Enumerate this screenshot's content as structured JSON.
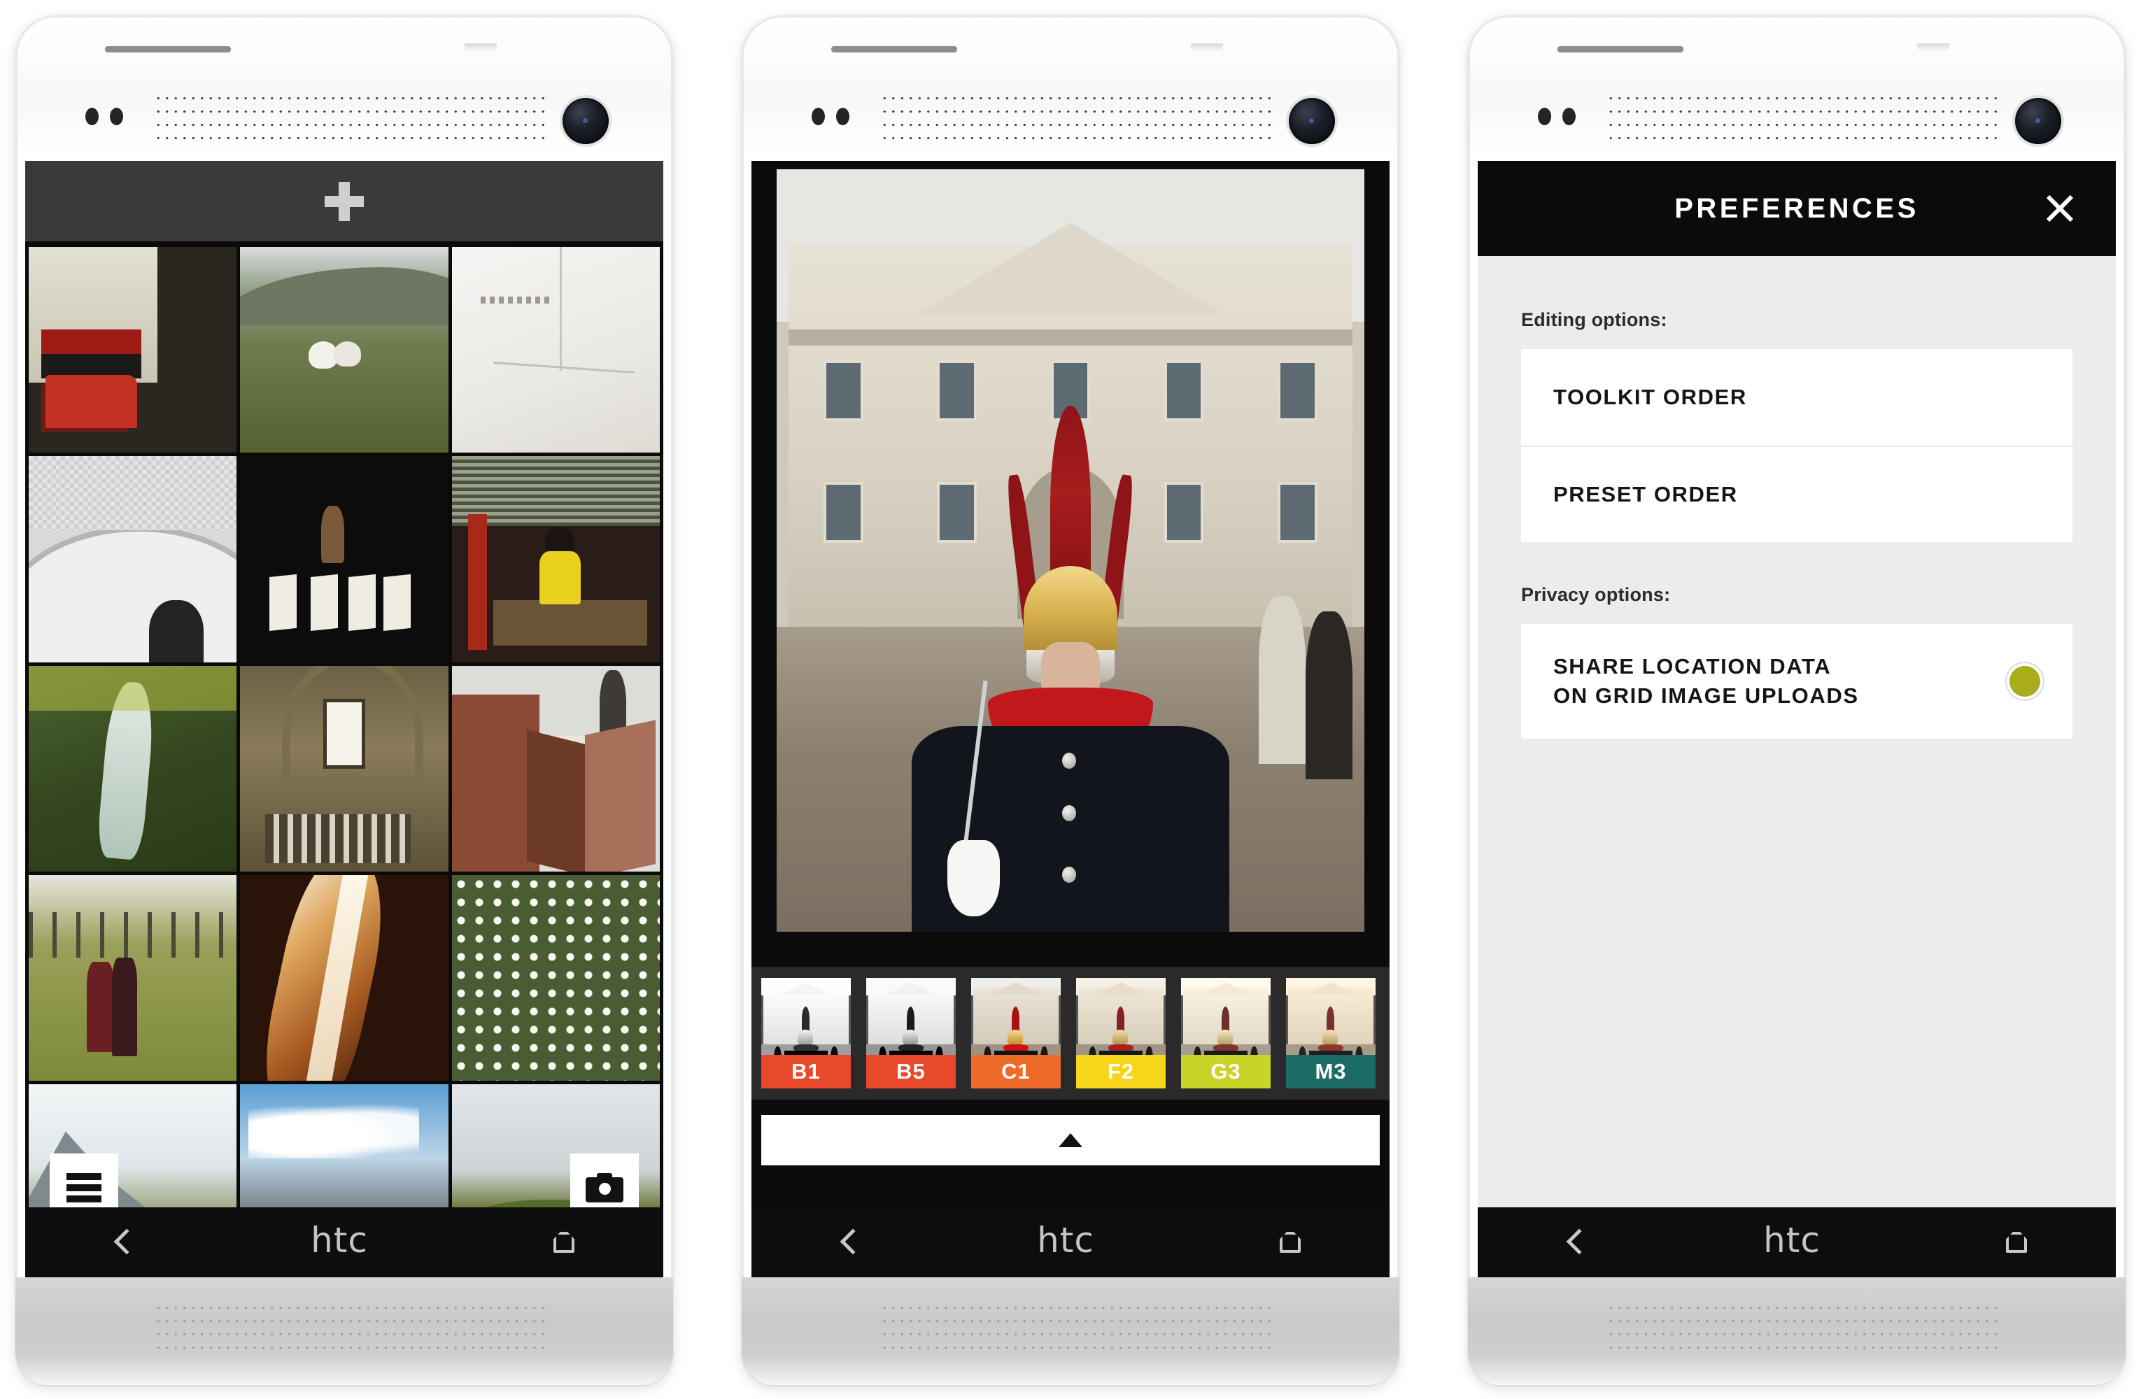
{
  "device": {
    "brand_logo": "htc",
    "nav_back_icon": "chevron-left-icon",
    "nav_home_icon": "home-icon"
  },
  "screens": [
    {
      "id": "grid",
      "name": "Grid / Library",
      "topbar": {
        "add_icon": "plus-icon",
        "add_label": "+"
      },
      "overlay_buttons": [
        {
          "name": "menu-button",
          "icon": "hamburger-icon"
        },
        {
          "name": "camera-button",
          "icon": "camera-icon"
        }
      ],
      "thumbnails": [
        {
          "alt": "Red car parked by building with awning"
        },
        {
          "alt": "Two white sheep on green hillside"
        },
        {
          "alt": "Minimal white wall corner with wire"
        },
        {
          "alt": "Black and white stone arch with person"
        },
        {
          "alt": "Dark gallery with framed white panels"
        },
        {
          "alt": "Person in yellow shirt at diner window"
        },
        {
          "alt": "Waterfall on green mountainside"
        },
        {
          "alt": "Church interior with tall window"
        },
        {
          "alt": "Red tiled rooftops and church tower"
        },
        {
          "alt": "Couple walking in autumn orchard"
        },
        {
          "alt": "Slot canyon light beam"
        },
        {
          "alt": "Field of white daisies"
        },
        {
          "alt": "Lake and mountain landscape"
        },
        {
          "alt": "Blue sky over snowy mountain range"
        },
        {
          "alt": "Green meadow under cloudy sky"
        }
      ]
    },
    {
      "id": "photo",
      "name": "Photo Editor",
      "hero": {
        "alt": "Household Cavalry guard in plumed helmet at Horse Guards, London"
      },
      "filters": [
        {
          "label": "B1",
          "color": "#e8492b"
        },
        {
          "label": "B5",
          "color": "#e8492b"
        },
        {
          "label": "C1",
          "color": "#ee6a28"
        },
        {
          "label": "F2",
          "color": "#f5d61b"
        },
        {
          "label": "G3",
          "color": "#c9d429"
        },
        {
          "label": "M3",
          "color": "#1d6b66"
        }
      ],
      "expand_bar": {
        "icon": "caret-up-icon"
      }
    },
    {
      "id": "preferences",
      "name": "Preferences",
      "header": {
        "title": "PREFERENCES",
        "close_icon": "close-icon"
      },
      "groups": [
        {
          "label": "Editing options:",
          "rows": [
            {
              "label": "TOOLKIT ORDER",
              "type": "link"
            },
            {
              "label": "PRESET ORDER",
              "type": "link"
            }
          ]
        },
        {
          "label": "Privacy options:",
          "rows": [
            {
              "label_line1": "SHARE LOCATION DATA",
              "label_line2": "ON GRID IMAGE UPLOADS",
              "type": "toggle",
              "toggle_on": true,
              "toggle_color": "#a9ad1a"
            }
          ]
        }
      ]
    }
  ],
  "colors": {
    "screen_black": "#0a0a0a",
    "grid_topbar": "#3a3a3a",
    "prefs_bg": "#ececec",
    "card_white": "#ffffff",
    "filter_strip": "#2a2a2a"
  }
}
